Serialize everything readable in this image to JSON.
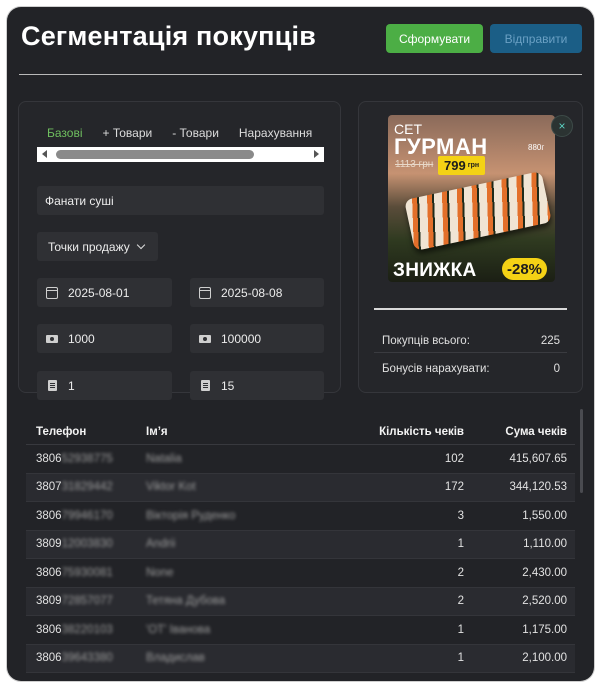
{
  "header": {
    "title": "Сегментація покупців",
    "generate_label": "Сформувати",
    "send_label": "Відправити"
  },
  "filters": {
    "tabs": [
      {
        "label": "Базові",
        "active": true
      },
      {
        "label": "+ Товари",
        "active": false
      },
      {
        "label": "- Товари",
        "active": false
      },
      {
        "label": "Нарахування",
        "active": false
      }
    ],
    "segment_name": "Фанати суші",
    "sales_points_label": "Точки продажу",
    "date_from": "2025-08-01",
    "date_to": "2025-08-08",
    "sum_from": "1000",
    "sum_to": "100000",
    "checks_from": "1",
    "checks_to": "15",
    "icons": {
      "date": "calendar-icon",
      "sum": "money-icon",
      "checks": "receipt-icon"
    }
  },
  "promo": {
    "set_label": "СЕТ",
    "name": "ГУРМАН",
    "weight": "880г",
    "old_price": "1113 грн",
    "new_price": "799",
    "new_price_currency": "грн",
    "discount_label": "ЗНИЖКА",
    "discount_value": "-28%",
    "close_symbol": "×"
  },
  "stats": {
    "purchases_label": "Покупців всього:",
    "purchases_value": "225",
    "bonus_label": "Бонусів нарахувати:",
    "bonus_value": "0"
  },
  "table": {
    "columns": [
      "Телефон",
      "Ім’я",
      "Кількість чеків",
      "Сума чеків"
    ],
    "rows": [
      {
        "phone_prefix": "3806",
        "phone_hidden": "52938775",
        "name": "Natalia",
        "checks": "102",
        "sum": "415,607.65"
      },
      {
        "phone_prefix": "3807",
        "phone_hidden": "31829442",
        "name": "Viktor Kot",
        "checks": "172",
        "sum": "344,120.53"
      },
      {
        "phone_prefix": "3806",
        "phone_hidden": "79946170",
        "name": "Вікторія Руденко",
        "checks": "3",
        "sum": "1,550.00"
      },
      {
        "phone_prefix": "3809",
        "phone_hidden": "12003830",
        "name": "Andrii",
        "checks": "1",
        "sum": "1,110.00"
      },
      {
        "phone_prefix": "3806",
        "phone_hidden": "75930081",
        "name": "None",
        "checks": "2",
        "sum": "2,430.00"
      },
      {
        "phone_prefix": "3809",
        "phone_hidden": "72857077",
        "name": "Тетяна Дубова",
        "checks": "2",
        "sum": "2,520.00"
      },
      {
        "phone_prefix": "3806",
        "phone_hidden": "38220103",
        "name": "'OT' Іванова",
        "checks": "1",
        "sum": "1,175.00"
      },
      {
        "phone_prefix": "3806",
        "phone_hidden": "39643380",
        "name": "Владислав",
        "checks": "1",
        "sum": "2,100.00"
      }
    ]
  }
}
